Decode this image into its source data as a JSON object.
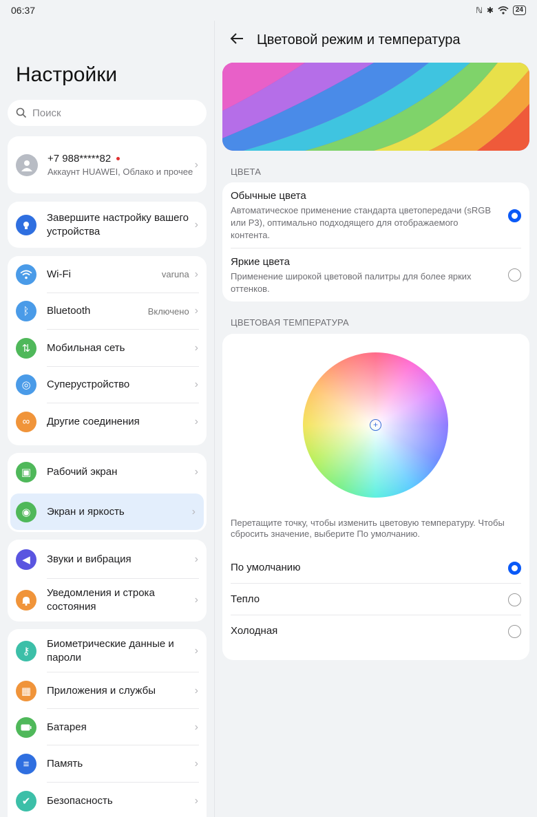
{
  "status": {
    "time": "06:37",
    "battery": "24"
  },
  "left": {
    "title": "Настройки",
    "search_placeholder": "Поиск",
    "account": {
      "phone": "+7 988*****82",
      "sub": "Аккаунт HUAWEI, Облако и прочее"
    },
    "setup": {
      "label": "Завершите настройку вашего устройства"
    },
    "group1": [
      {
        "label": "Wi-Fi",
        "value": "varuna",
        "icon": "wifi-icon",
        "color": "#4a9be8"
      },
      {
        "label": "Bluetooth",
        "value": "Включено",
        "icon": "bluetooth-icon",
        "color": "#4a9be8"
      },
      {
        "label": "Мобильная сеть",
        "value": "",
        "icon": "mobile-network-icon",
        "color": "#4fb85a"
      },
      {
        "label": "Суперустройство",
        "value": "",
        "icon": "superdevice-icon",
        "color": "#4a9be8"
      },
      {
        "label": "Другие соединения",
        "value": "",
        "icon": "link-icon",
        "color": "#f0943a"
      }
    ],
    "group2": [
      {
        "label": "Рабочий экран",
        "icon": "home-screen-icon",
        "color": "#4fb85a"
      },
      {
        "label": "Экран и яркость",
        "icon": "eye-icon",
        "color": "#4fb85a"
      }
    ],
    "group3": [
      {
        "label": "Звуки и вибрация",
        "icon": "sound-icon",
        "color": "#5a55e0"
      },
      {
        "label": "Уведомления и строка состояния",
        "icon": "bell-icon",
        "color": "#f0943a"
      }
    ],
    "group4": [
      {
        "label": "Биометрические данные и пароли",
        "icon": "key-icon",
        "color": "#3cbfa8"
      },
      {
        "label": "Приложения и службы",
        "icon": "apps-icon",
        "color": "#f0943a"
      },
      {
        "label": "Батарея",
        "icon": "battery-icon",
        "color": "#4fb85a"
      },
      {
        "label": "Память",
        "icon": "storage-icon",
        "color": "#2f6fe0"
      },
      {
        "label": "Безопасность",
        "icon": "shield-icon",
        "color": "#3cbfa8"
      }
    ]
  },
  "right": {
    "title": "Цветовой режим и температура",
    "colors_label": "ЦВЕТА",
    "normal": {
      "title": "Обычные цвета",
      "desc": "Автоматическое применение стандарта цветопередачи (sRGB или P3), оптимально подходящего для отображаемого контента."
    },
    "vivid": {
      "title": "Яркие цвета",
      "desc": "Применение широкой цветовой палитры для более ярких оттенков."
    },
    "temp_label": "ЦВЕТОВАЯ ТЕМПЕРАТУРА",
    "hint": "Перетащите точку, чтобы изменить цветовую температуру. Чтобы сбросить значение, выберите По умолчанию.",
    "temp_options": [
      "По умолчанию",
      "Тепло",
      "Холодная"
    ],
    "accent": "#0a59f7"
  }
}
